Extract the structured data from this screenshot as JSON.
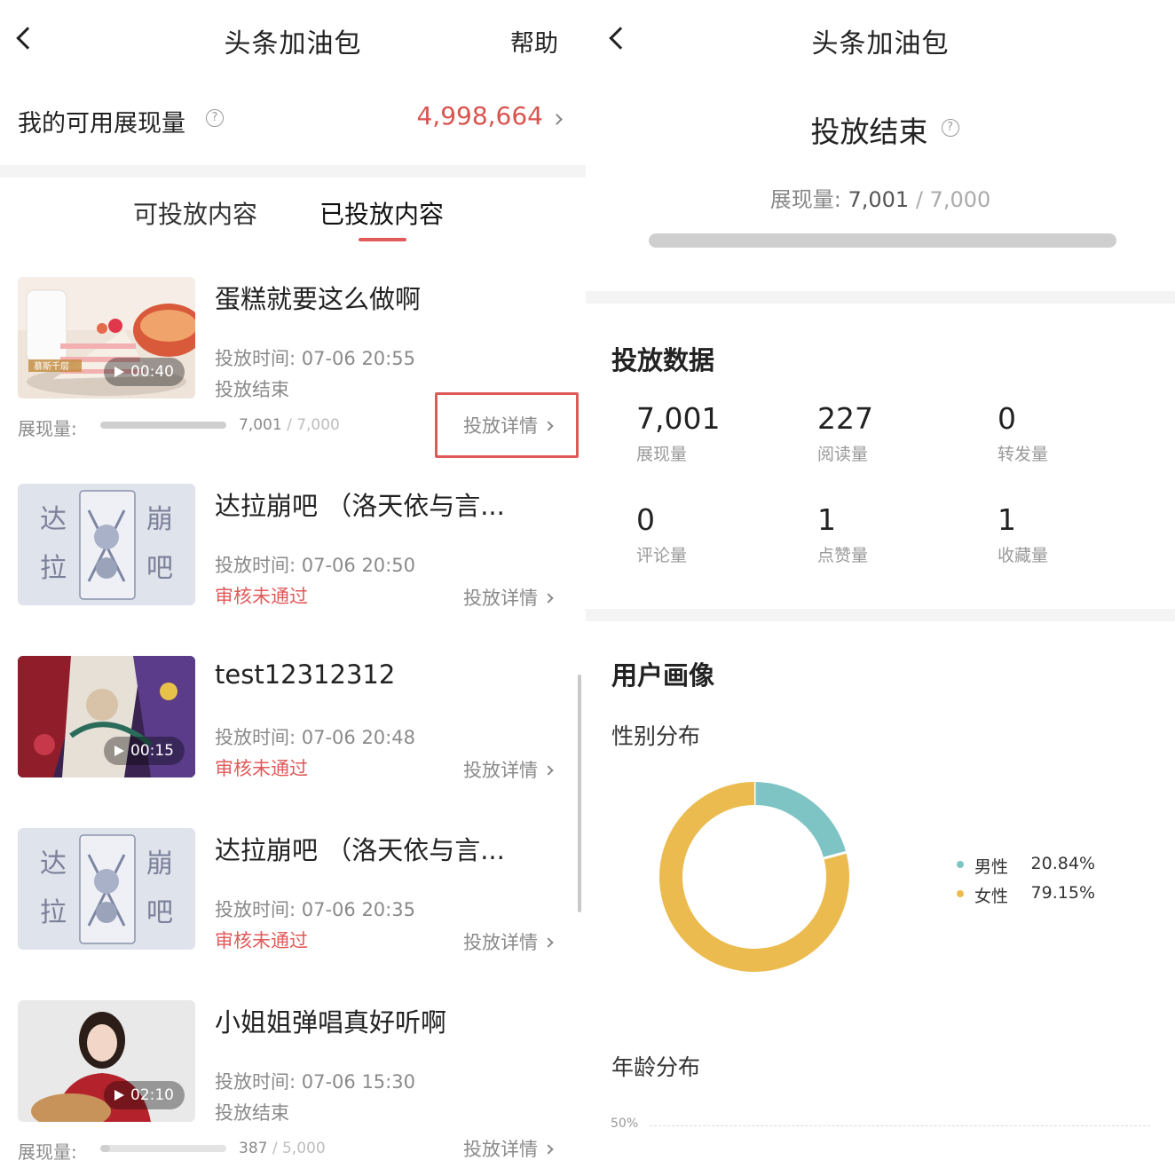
{
  "left": {
    "nav": {
      "title": "头条加油包",
      "help": "帮助"
    },
    "available": {
      "label": "我的可用展现量",
      "value": "4,998,664"
    },
    "tabs": [
      {
        "label": "可投放内容"
      },
      {
        "label": "已投放内容"
      }
    ],
    "impressions_label": "展现量:",
    "items": [
      {
        "title": "蛋糕就要这么做啊",
        "time": "投放时间: 07-06 20:55",
        "status": "投放结束",
        "status_type": "ended",
        "duration": "00:40",
        "detail": "投放详情",
        "impressions": "7,001",
        "impressions_total": "/ 7,000",
        "progress": 1.0
      },
      {
        "title": "达拉崩吧 （洛天依与言...",
        "time": "投放时间: 07-06 20:50",
        "status": "审核未通过",
        "status_type": "rejected",
        "duration": "",
        "detail": "投放详情"
      },
      {
        "title": "test12312312",
        "time": "投放时间: 07-06 20:48",
        "status": "审核未通过",
        "status_type": "rejected",
        "duration": "00:15",
        "detail": "投放详情"
      },
      {
        "title": "达拉崩吧 （洛天依与言...",
        "time": "投放时间: 07-06 20:35",
        "status": "审核未通过",
        "status_type": "rejected",
        "duration": "",
        "detail": "投放详情"
      },
      {
        "title": "小姐姐弹唱真好听啊",
        "time": "投放时间: 07-06 15:30",
        "status": "投放结束",
        "status_type": "ended",
        "duration": "02:10",
        "detail": "投放详情",
        "impressions": "387",
        "impressions_total": "/ 5,000",
        "progress": 0.0774
      }
    ],
    "thumb_text": {
      "cake_overlay": "慕斯千层",
      "card_left_top": "达",
      "card_left_bottom": "拉",
      "card_right_top": "崩",
      "card_right_bottom": "吧"
    }
  },
  "right": {
    "nav": {
      "title": "头条加油包"
    },
    "status_title": "投放结束",
    "impressions_label": "展现量:",
    "impressions_value": "7,001",
    "impressions_total": "/ 7,000",
    "progress": 1.0,
    "data_section": {
      "title": "投放数据",
      "stats": [
        {
          "value": "7,001",
          "label": "展现量"
        },
        {
          "value": "227",
          "label": "阅读量"
        },
        {
          "value": "0",
          "label": "转发量"
        },
        {
          "value": "0",
          "label": "评论量"
        },
        {
          "value": "1",
          "label": "点赞量"
        },
        {
          "value": "1",
          "label": "收藏量"
        }
      ]
    },
    "portrait": {
      "title": "用户画像",
      "gender_title": "性别分布",
      "age_title": "年龄分布",
      "age_axis_tick": "50%"
    }
  },
  "chart_data": {
    "type": "pie",
    "title": "性别分布",
    "donut": true,
    "categories": [
      "男性",
      "女性"
    ],
    "values": [
      20.84,
      79.15
    ],
    "value_labels": [
      "20.84%",
      "79.15%"
    ],
    "colors": [
      "#7fc4c4",
      "#ecbb50"
    ],
    "legend_position": "right"
  },
  "colors": {
    "accent": "#e05a5a",
    "available_value": "#d9534f",
    "male": "#7fc4c4",
    "female": "#ecbb50"
  }
}
